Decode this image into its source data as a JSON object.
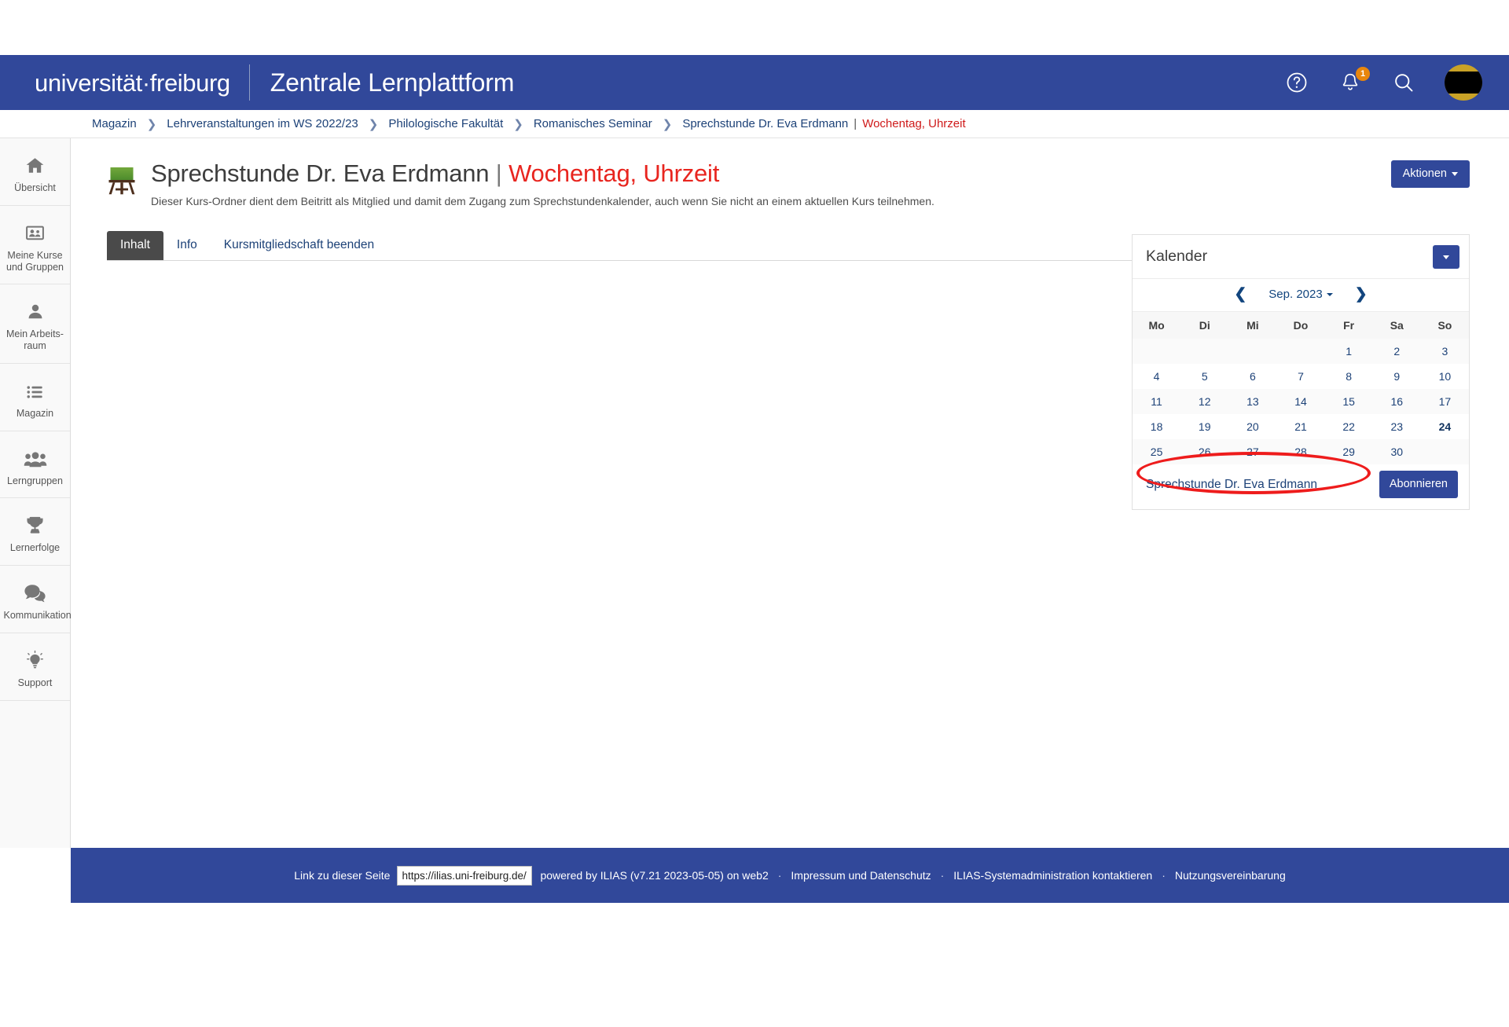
{
  "header": {
    "brand": "universität·freiburg",
    "system_title": "Zentrale Lernplattform",
    "help_icon": "question-circle-icon",
    "notifications_icon": "bell-icon",
    "notifications_count": "1",
    "search_icon": "search-icon",
    "avatar_label": "user-avatar",
    "background_color": "#31489a"
  },
  "breadcrumb": {
    "items": [
      {
        "label": "Magazin",
        "current": false
      },
      {
        "label": "Lehrveranstaltungen im WS 2022/23",
        "current": false
      },
      {
        "label": "Philologische Fakultät",
        "current": false
      },
      {
        "label": "Romanisches Seminar",
        "current": false
      },
      {
        "label": "Sprechstunde Dr. Eva Erdmann",
        "current": false
      }
    ],
    "separator": "❯",
    "pipe": "|",
    "current_red": "Wochentag, Uhrzeit",
    "current_color": "#cf1a1a"
  },
  "sidebar": {
    "items": [
      {
        "label": "Übersicht",
        "icon": "home-icon"
      },
      {
        "label": "Meine Kurse und Gruppen",
        "icon": "courses-icon"
      },
      {
        "label": "Mein Arbeits-raum",
        "icon": "person-icon"
      },
      {
        "label": "Magazin",
        "icon": "list-icon"
      },
      {
        "label": "Lerngruppen",
        "icon": "group-icon"
      },
      {
        "label": "Lernerfolge",
        "icon": "trophy-icon"
      },
      {
        "label": "Kommunikation",
        "icon": "chat-icon"
      },
      {
        "label": "Support",
        "icon": "lightbulb-icon"
      }
    ]
  },
  "main": {
    "object_icon": "blackboard-easel-icon",
    "title_main": "Sprechstunde Dr. Eva Erdmann",
    "title_pipe": "|",
    "title_red": "Wochentag, Uhrzeit",
    "description": "Dieser Kurs-Ordner dient dem Beitritt als Mitglied und damit dem Zugang zum Sprechstundenkalender, auch wenn Sie nicht an einem aktuellen Kurs teilnehmen.",
    "actions_label": "Aktionen",
    "tabs": [
      {
        "label": "Inhalt",
        "active": true
      },
      {
        "label": "Info",
        "active": false
      },
      {
        "label": "Kursmitgliedschaft beenden",
        "active": false
      }
    ]
  },
  "calendar": {
    "title": "Kalender",
    "dropdown_icon": "chevron-down-icon",
    "prev_icon": "chevron-left-icon",
    "next_icon": "chevron-right-icon",
    "month_label": "Sep. 2023",
    "weekdays": [
      "Mo",
      "Di",
      "Mi",
      "Do",
      "Fr",
      "Sa",
      "So"
    ],
    "weeks": [
      [
        "",
        "",
        "",
        "",
        "1",
        "2",
        "3"
      ],
      [
        "4",
        "5",
        "6",
        "7",
        "8",
        "9",
        "10"
      ],
      [
        "11",
        "12",
        "13",
        "14",
        "15",
        "16",
        "17"
      ],
      [
        "18",
        "19",
        "20",
        "21",
        "22",
        "23",
        "24"
      ],
      [
        "25",
        "26",
        "27",
        "28",
        "29",
        "30",
        ""
      ]
    ],
    "today": "24",
    "calendar_link": "Sprechstunde Dr. Eva Erdmann",
    "subscribe_label": "Abonnieren",
    "annotation_color": "#ee1c1c"
  },
  "footer": {
    "link_label": "Link zu dieser Seite",
    "url_value": "https://ilias.uni-freiburg.de/",
    "powered_by": "powered by ILIAS (v7.21 2023-05-05) on web2",
    "separator": "·",
    "links": [
      "Impressum und Datenschutz",
      "ILIAS-Systemadministration kontaktieren",
      "Nutzungsvereinbarung"
    ]
  }
}
